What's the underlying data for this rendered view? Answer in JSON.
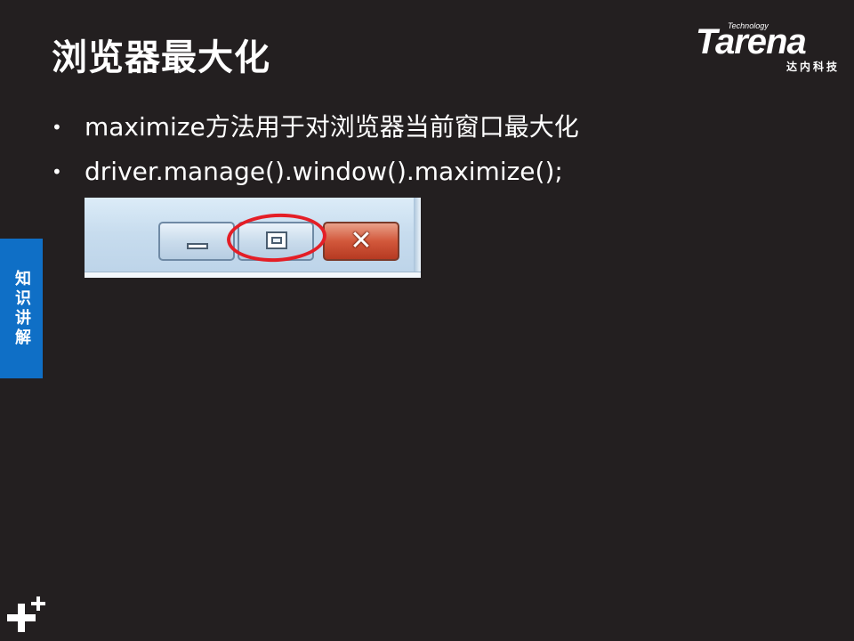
{
  "slide": {
    "title": "浏览器最大化",
    "bullets": [
      "maximize方法用于对浏览器当前窗口最大化",
      "driver.manage().window().maximize();"
    ]
  },
  "logo": {
    "tagline": "Technology",
    "wordmark": "Tarena",
    "cn_name": "达内科技"
  },
  "side_tab": {
    "label": "知识讲解"
  },
  "screenshot": {
    "buttons": [
      {
        "name": "minimize",
        "icon": "minimize-icon"
      },
      {
        "name": "maximize",
        "icon": "maximize-icon",
        "highlighted": true
      },
      {
        "name": "close",
        "icon": "close-icon",
        "glyph": "✕"
      }
    ]
  },
  "colors": {
    "background": "#231f20",
    "text": "#ffffff",
    "side_tab": "#0f6fc6",
    "highlight_ring": "#e41e26",
    "close_button": "#d2583b"
  },
  "icons": {
    "corner_decoration": "plus-plus-icon"
  }
}
